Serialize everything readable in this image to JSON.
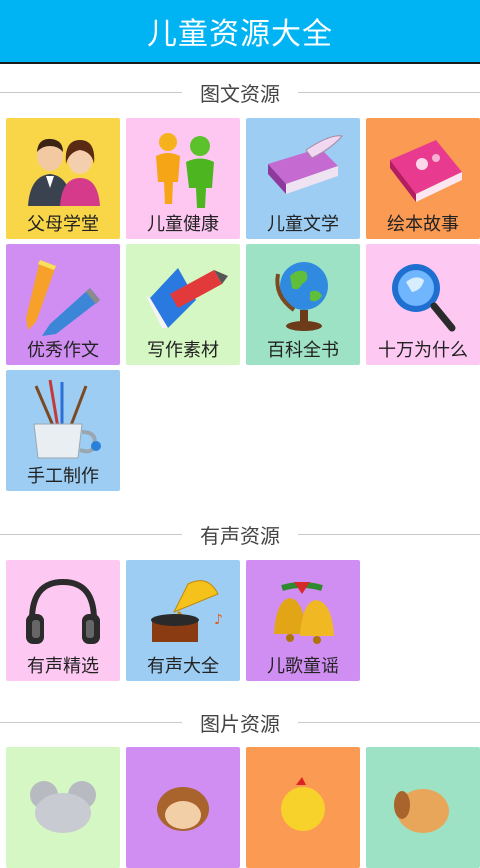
{
  "app": {
    "title": "儿童资源大全"
  },
  "sections": [
    {
      "label": "图文资源",
      "items": [
        {
          "label": "父母学堂",
          "icon": "parents-icon",
          "color": "#f9d648"
        },
        {
          "label": "儿童健康",
          "icon": "children-figures-icon",
          "color": "#fdc7f2"
        },
        {
          "label": "儿童文学",
          "icon": "book-quill-icon",
          "color": "#9dcdf3"
        },
        {
          "label": "绘本故事",
          "icon": "pink-notebook-icon",
          "color": "#fb9b53"
        },
        {
          "label": "优秀作文",
          "icon": "pencils-icon",
          "color": "#d08ef2"
        },
        {
          "label": "写作素材",
          "icon": "pencil-paper-icon",
          "color": "#d5f7c3"
        },
        {
          "label": "百科全书",
          "icon": "globe-icon",
          "color": "#9ee2c6"
        },
        {
          "label": "十万为什么",
          "icon": "magnifier-globe-icon",
          "color": "#fdc9f3"
        },
        {
          "label": "手工制作",
          "icon": "paint-brushes-cup-icon",
          "color": "#9dcdf3"
        }
      ]
    },
    {
      "label": "有声资源",
      "items": [
        {
          "label": "有声精选",
          "icon": "headphones-icon",
          "color": "#fdc9f3"
        },
        {
          "label": "有声大全",
          "icon": "gramophone-icon",
          "color": "#9dcdf3"
        },
        {
          "label": "儿歌童谣",
          "icon": "bells-icon",
          "color": "#d08ef2"
        }
      ]
    },
    {
      "label": "图片资源",
      "items": [
        {
          "label": "",
          "icon": "mouse-cartoon-icon",
          "color": "#d5f7c3"
        },
        {
          "label": "",
          "icon": "monkey-cartoon-icon",
          "color": "#d08ef2"
        },
        {
          "label": "",
          "icon": "chick-cartoon-icon",
          "color": "#fb9b53"
        },
        {
          "label": "",
          "icon": "puppy-cartoon-icon",
          "color": "#9ee2c6"
        }
      ]
    }
  ]
}
